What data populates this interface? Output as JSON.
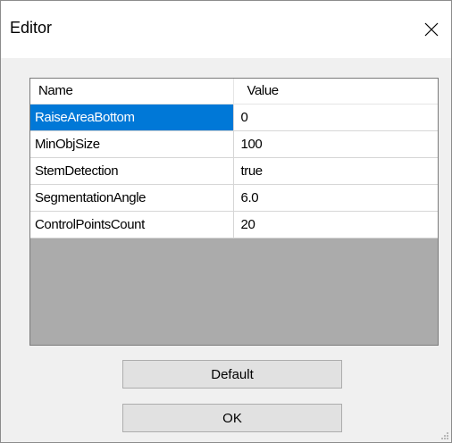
{
  "window": {
    "title": "Editor",
    "close_icon": "close-icon"
  },
  "grid": {
    "columns": [
      "Name",
      "Value"
    ],
    "rows": [
      {
        "name": "RaiseAreaBottom",
        "value": "0",
        "selected": true
      },
      {
        "name": "MinObjSize",
        "value": "100"
      },
      {
        "name": "StemDetection",
        "value": "true"
      },
      {
        "name": "SegmentationAngle",
        "value": "6.0"
      },
      {
        "name": "ControlPointsCount",
        "value": "20"
      }
    ]
  },
  "buttons": {
    "default_label": "Default",
    "ok_label": "OK"
  },
  "colors": {
    "selection": "#0078d7",
    "grid_background": "#ababab",
    "dialog_background": "#f0f0f0"
  }
}
